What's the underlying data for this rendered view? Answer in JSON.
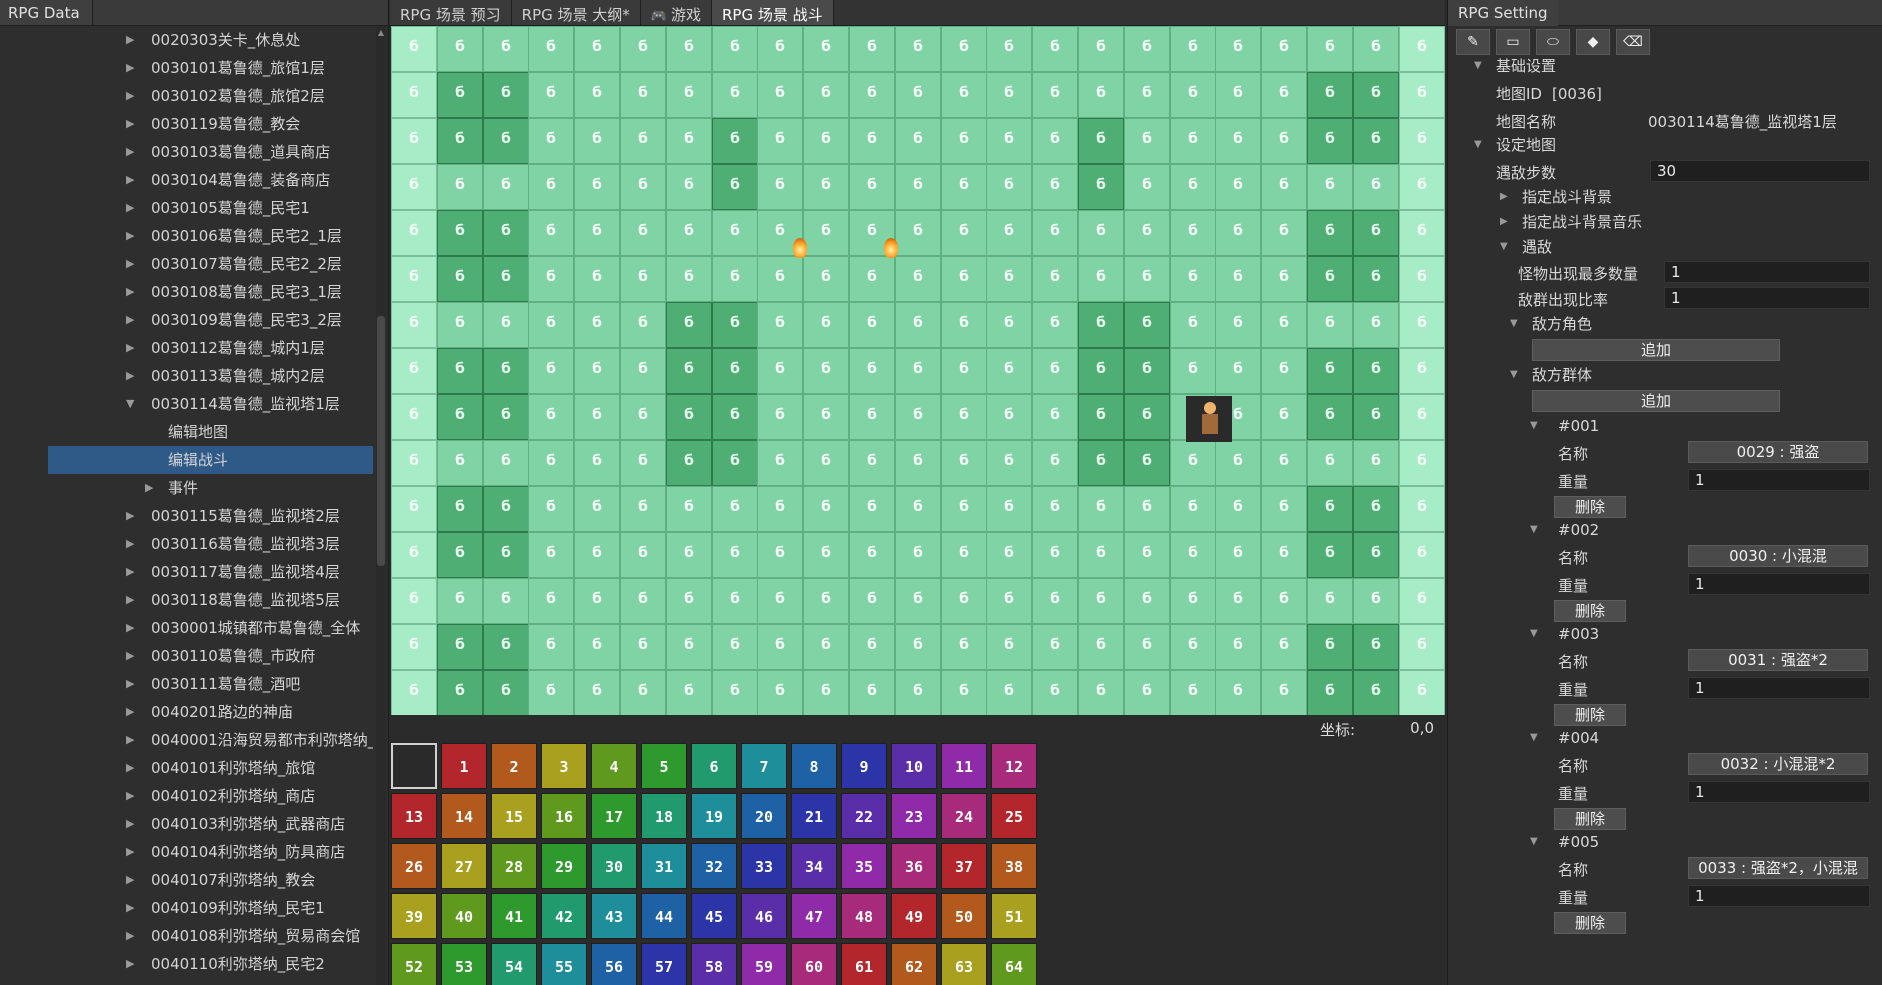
{
  "left_panel": {
    "tab": "RPG Data",
    "tree": [
      {
        "label": "0020303关卡_休息处",
        "level": 0
      },
      {
        "label": "0030101葛鲁德_旅馆1层",
        "level": 0
      },
      {
        "label": "0030102葛鲁德_旅馆2层",
        "level": 0
      },
      {
        "label": "0030119葛鲁德_教会",
        "level": 0
      },
      {
        "label": "0030103葛鲁德_道具商店",
        "level": 0
      },
      {
        "label": "0030104葛鲁德_装备商店",
        "level": 0
      },
      {
        "label": "0030105葛鲁德_民宅1",
        "level": 0
      },
      {
        "label": "0030106葛鲁德_民宅2_1层",
        "level": 0
      },
      {
        "label": "0030107葛鲁德_民宅2_2层",
        "level": 0
      },
      {
        "label": "0030108葛鲁德_民宅3_1层",
        "level": 0
      },
      {
        "label": "0030109葛鲁德_民宅3_2层",
        "level": 0
      },
      {
        "label": "0030112葛鲁德_城内1层",
        "level": 0
      },
      {
        "label": "0030113葛鲁德_城内2层",
        "level": 0
      },
      {
        "label": "0030114葛鲁德_监视塔1层",
        "level": 0,
        "expanded": true
      },
      {
        "label": "编辑地图",
        "level": 1
      },
      {
        "label": "编辑战斗",
        "level": 1,
        "selected": true
      },
      {
        "label": "事件",
        "level": 2
      },
      {
        "label": "0030115葛鲁德_监视塔2层",
        "level": 0
      },
      {
        "label": "0030116葛鲁德_监视塔3层",
        "level": 0
      },
      {
        "label": "0030117葛鲁德_监视塔4层",
        "level": 0
      },
      {
        "label": "0030118葛鲁德_监视塔5层",
        "level": 0
      },
      {
        "label": "0030001城镇都市葛鲁德_全体",
        "level": 0
      },
      {
        "label": "0030110葛鲁德_市政府",
        "level": 0
      },
      {
        "label": "0030111葛鲁德_酒吧",
        "level": 0
      },
      {
        "label": "0040201路边的神庙",
        "level": 0
      },
      {
        "label": "0040001沿海贸易都市利弥塔纳_",
        "level": 0
      },
      {
        "label": "0040101利弥塔纳_旅馆",
        "level": 0
      },
      {
        "label": "0040102利弥塔纳_商店",
        "level": 0
      },
      {
        "label": "0040103利弥塔纳_武器商店",
        "level": 0
      },
      {
        "label": "0040104利弥塔纳_防具商店",
        "level": 0
      },
      {
        "label": "0040107利弥塔纳_教会",
        "level": 0
      },
      {
        "label": "0040109利弥塔纳_民宅1",
        "level": 0
      },
      {
        "label": "0040108利弥塔纳_贸易商会馆",
        "level": 0
      },
      {
        "label": "0040110利弥塔纳_民宅2",
        "level": 0
      }
    ]
  },
  "center": {
    "tabs": [
      {
        "label": "RPG 场景 预习",
        "active": false
      },
      {
        "label": "RPG 场景 大纲*",
        "active": false
      },
      {
        "label": "游戏",
        "active": false,
        "icon": "gamepad-icon"
      },
      {
        "label": "RPG 场景 战斗",
        "active": true
      }
    ],
    "tile_glyph": "б",
    "coord_label": "坐标:",
    "coord_value": "0,0",
    "palette": [
      "",
      "1",
      "2",
      "3",
      "4",
      "5",
      "6",
      "7",
      "8",
      "9",
      "10",
      "11",
      "12",
      "13",
      "14",
      "15",
      "16",
      "17",
      "18",
      "19",
      "20",
      "21",
      "22",
      "23",
      "24",
      "25",
      "26",
      "27",
      "28",
      "29",
      "30",
      "31",
      "32",
      "33",
      "34",
      "35",
      "36",
      "37",
      "38",
      "39",
      "40",
      "41",
      "42",
      "43",
      "44",
      "45",
      "46",
      "47",
      "48",
      "49",
      "50",
      "51",
      "52",
      "53",
      "54",
      "55",
      "56",
      "57",
      "58",
      "59",
      "60",
      "61",
      "62",
      "63",
      "64"
    ],
    "palette_colors": [
      "#2a2a2a",
      "#b3262b",
      "#b25a1e",
      "#a8a01e",
      "#5f9a1e",
      "#2e9a2e",
      "#219a6e",
      "#1e8f9a",
      "#1e62a5",
      "#2c35a8",
      "#5a2ea8",
      "#8f2aa8",
      "#a82a7a",
      "#b3262b",
      "#b25a1e",
      "#a8a01e",
      "#5f9a1e",
      "#2e9a2e",
      "#219a6e",
      "#1e8f9a",
      "#1e62a5",
      "#2c35a8",
      "#5a2ea8",
      "#8f2aa8",
      "#a82a7a",
      "#b3262b",
      "#b25a1e",
      "#a8a01e",
      "#5f9a1e",
      "#2e9a2e",
      "#219a6e",
      "#1e8f9a",
      "#1e62a5",
      "#2c35a8",
      "#5a2ea8",
      "#8f2aa8",
      "#a82a7a",
      "#b3262b",
      "#b25a1e",
      "#a8a01e",
      "#5f9a1e",
      "#2e9a2e",
      "#219a6e",
      "#1e8f9a",
      "#1e62a5",
      "#2c35a8",
      "#5a2ea8",
      "#8f2aa8",
      "#a82a7a",
      "#b3262b",
      "#b25a1e",
      "#a8a01e",
      "#5f9a1e",
      "#2e9a2e",
      "#219a6e",
      "#1e8f9a",
      "#1e62a5",
      "#2c35a8",
      "#5a2ea8",
      "#8f2aa8",
      "#a82a7a",
      "#b3262b",
      "#b25a1e",
      "#a8a01e",
      "#5f9a1e"
    ]
  },
  "right_panel": {
    "tab": "RPG Setting",
    "tools": [
      "pencil-icon",
      "rectangle-icon",
      "ellipse-icon",
      "fill-icon",
      "eraser-icon"
    ],
    "basic_settings": "基础设置",
    "map_id_label": "地图ID",
    "map_id_value": "[0036]",
    "map_name_label": "地图名称",
    "map_name_value": "0030114葛鲁德_监视塔1层",
    "set_map": "设定地图",
    "encounter_steps_label": "遇敌步数",
    "encounter_steps_value": "30",
    "battle_bg": "指定战斗背景",
    "battle_bgm": "指定战斗背景音乐",
    "encounter": "遇敌",
    "max_monsters_label": "怪物出现最多数量",
    "max_monsters_value": "1",
    "group_rate_label": "敌群出现比率",
    "group_rate_value": "1",
    "enemy_roles": "敌方角色",
    "add": "追加",
    "enemy_groups": "敌方群体",
    "name_label": "名称",
    "weight_label": "重量",
    "delete": "删除",
    "groups": [
      {
        "id": "#001",
        "name": "0029 : 强盗",
        "weight": "1"
      },
      {
        "id": "#002",
        "name": "0030 : 小混混",
        "weight": "1"
      },
      {
        "id": "#003",
        "name": "0031 : 强盗*2",
        "weight": "1"
      },
      {
        "id": "#004",
        "name": "0032 : 小混混*2",
        "weight": "1"
      },
      {
        "id": "#005",
        "name": "0033 : 强盗*2，小混混",
        "weight": "1"
      }
    ]
  }
}
